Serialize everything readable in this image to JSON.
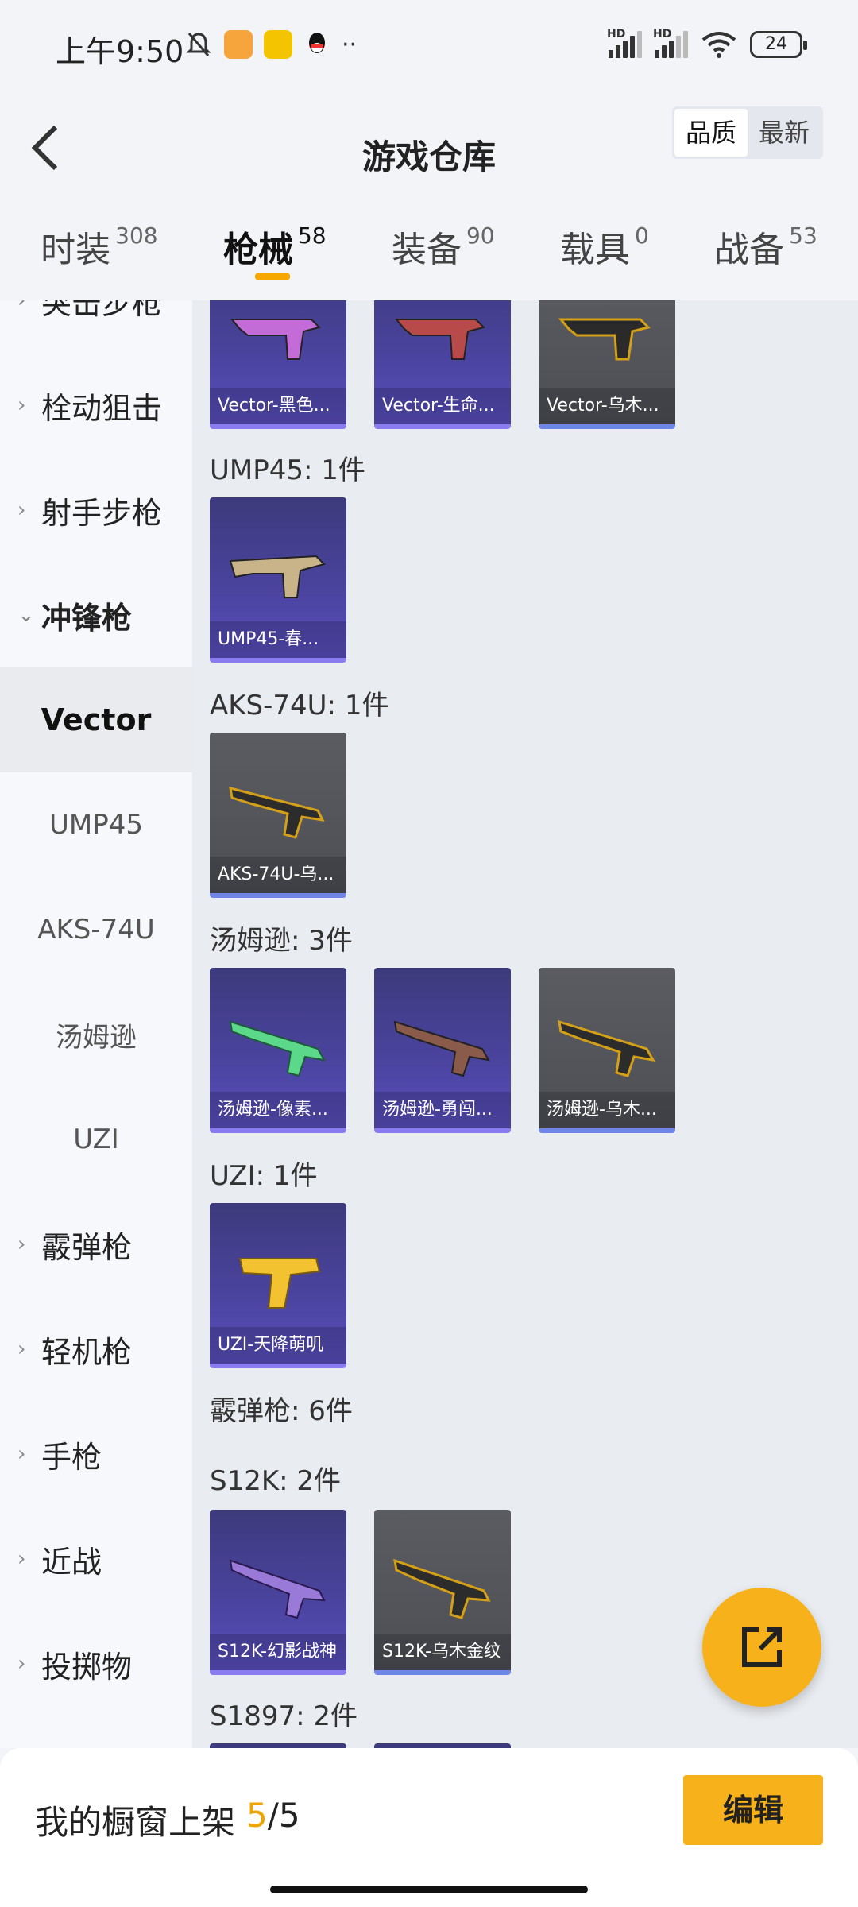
{
  "status_bar": {
    "time": "上午9:50",
    "battery": "24",
    "hd": "HD"
  },
  "header": {
    "title": "游戏仓库",
    "sort_options": [
      "品质",
      "最新"
    ],
    "sort_selected": "品质"
  },
  "tabs": [
    {
      "label": "时装",
      "count": "308"
    },
    {
      "label": "枪械",
      "count": "58",
      "active": true
    },
    {
      "label": "装备",
      "count": "90"
    },
    {
      "label": "载具",
      "count": "0"
    },
    {
      "label": "战备",
      "count": "53"
    }
  ],
  "sidebar": {
    "categories_top": [
      "突击步枪",
      "栓动狙击",
      "射手步枪"
    ],
    "open_category": "冲锋枪",
    "subcategories": [
      "Vector",
      "UMP45",
      "AKS-74U",
      "汤姆逊",
      "UZI"
    ],
    "selected_sub": "Vector",
    "categories_bottom": [
      "霰弹枪",
      "轻机枪",
      "手枪",
      "近战",
      "投掷物"
    ]
  },
  "main": {
    "vector_items": [
      "Vector-黑色...",
      "Vector-生命...",
      "Vector-乌木..."
    ],
    "ump45": {
      "title": "UMP45: 1件",
      "items": [
        "UMP45-春..."
      ]
    },
    "aks74u": {
      "title": "AKS-74U: 1件",
      "items": [
        "AKS-74U-乌..."
      ]
    },
    "thompson": {
      "title": "汤姆逊: 3件",
      "items": [
        "汤姆逊-像素...",
        "汤姆逊-勇闯...",
        "汤姆逊-乌木..."
      ]
    },
    "uzi": {
      "title": "UZI: 1件",
      "items": [
        "UZI-天降萌叽"
      ]
    },
    "shotgun_title": "霰弹枪: 6件",
    "s12k": {
      "title": "S12K: 2件",
      "items": [
        "S12K-幻影战神",
        "S12K-乌木金纹"
      ]
    },
    "s1897": {
      "title": "S1897: 2件"
    }
  },
  "bottom": {
    "showcase_label": "我的橱窗上架",
    "showcase_current": "5",
    "showcase_total": "/5",
    "edit_label": "编辑"
  },
  "colors": {
    "accent": "#f7b21b",
    "card_purple": "#4b44a0",
    "card_gray": "#505258"
  }
}
